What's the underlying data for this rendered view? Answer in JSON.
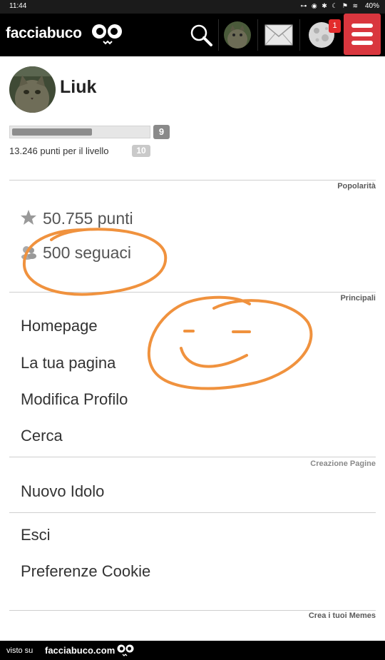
{
  "status_bar": {
    "time": "11:44",
    "icons": "⊶ ◉ ✱ ☾ ⚑ ≋",
    "battery": "40%"
  },
  "top_bar": {
    "logo": "facciabuco",
    "notification_count": "1",
    "colors": {
      "background": "#000000",
      "menu_button": "#d9363e",
      "badge": "#e32b2b"
    }
  },
  "profile": {
    "username": "Liuk",
    "level": "9",
    "next_level": "10",
    "points_to_next": "13.246 punti per il livello",
    "level_progress_fraction": 0.57
  },
  "sections": {
    "popularity": "Popolarità",
    "main": "Principali",
    "page_creation": "Creazione Pagine",
    "memes": "Crea i tuoi Memes"
  },
  "stats": {
    "points": "50.755 punti",
    "followers": "500 seguaci"
  },
  "menu": {
    "homepage": "Homepage",
    "your_page": "La tua pagina",
    "edit_profile": "Modifica Profilo",
    "search": "Cerca",
    "new_idol": "Nuovo Idolo",
    "logout": "Esci",
    "cookie_prefs": "Preferenze Cookie"
  },
  "footer": {
    "visto_su": "visto su",
    "brand": "facciabuco.com"
  },
  "annotation_color": "#f0923e"
}
